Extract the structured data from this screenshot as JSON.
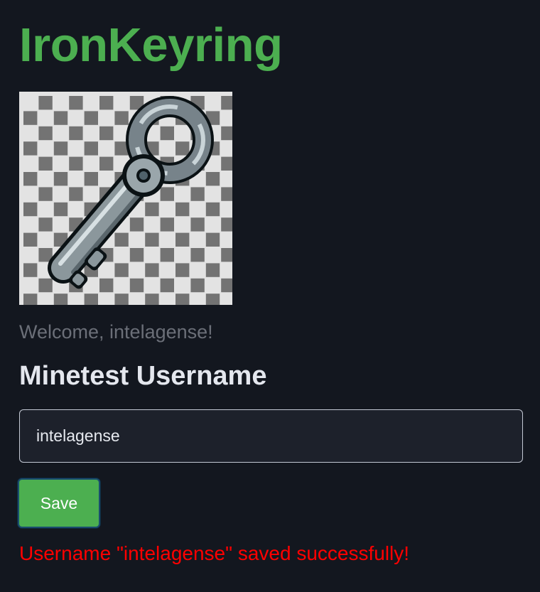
{
  "header": {
    "title": "IronKeyring"
  },
  "logo": {
    "icon": "iron-key-icon"
  },
  "welcome": {
    "text": "Welcome, intelagense!"
  },
  "form": {
    "heading": "Minetest Username",
    "username_value": "intelagense",
    "save_label": "Save"
  },
  "status": {
    "message": "Username \"intelagense\" saved successfully!"
  },
  "colors": {
    "background": "#13171f",
    "title": "#4caf50",
    "heading": "#e4e7ee",
    "welcome": "#6b6f78",
    "input_bg": "#1d212b",
    "input_text": "#e6e9ef",
    "button_bg": "#4caf50",
    "button_text": "#ffffff",
    "success_text": "#ff0000"
  }
}
